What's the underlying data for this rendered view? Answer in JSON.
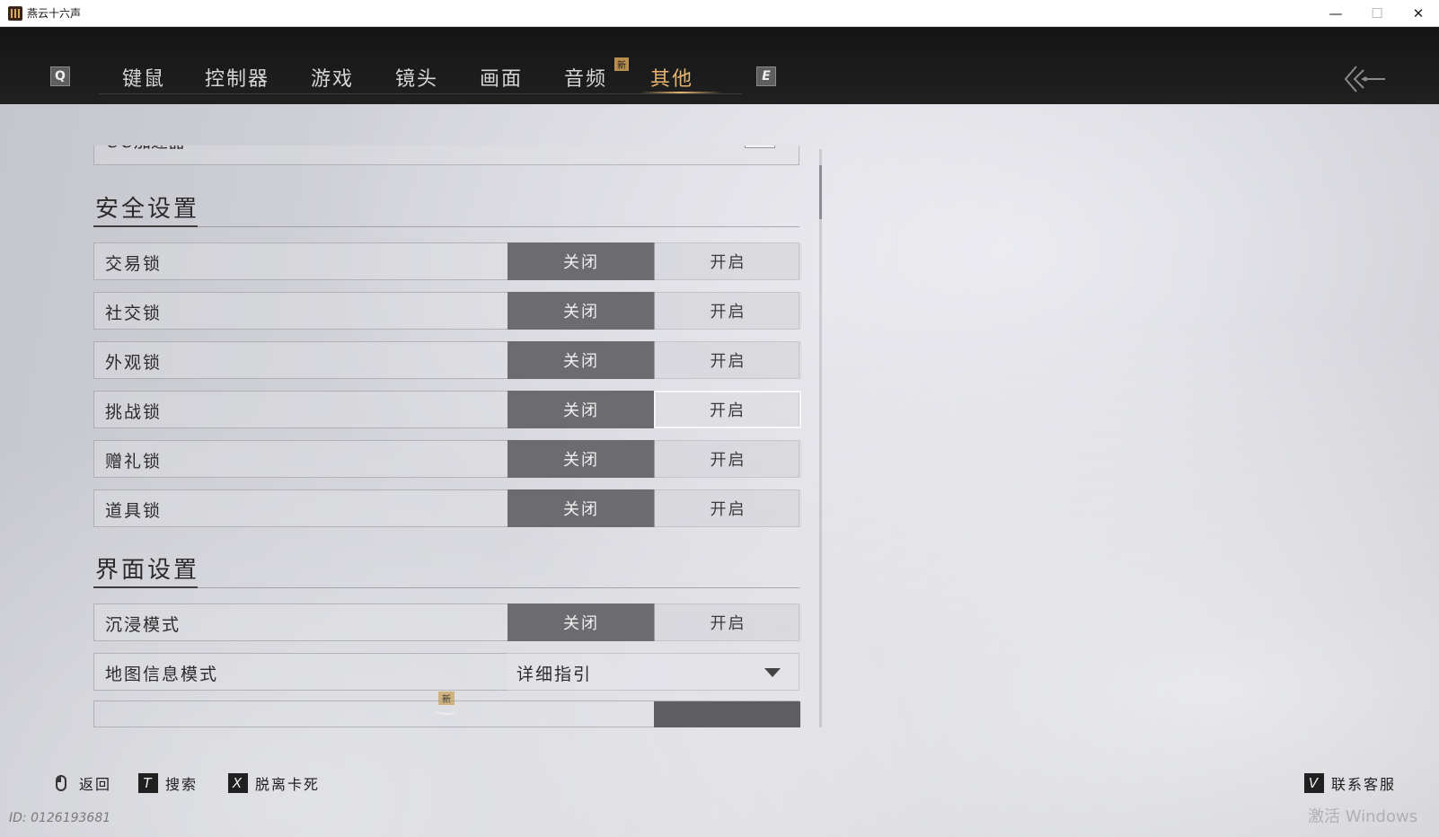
{
  "window": {
    "title": "燕云十六声",
    "minimize": "—",
    "maximize": "☐",
    "close": "✕"
  },
  "nav": {
    "left_key": "Q",
    "right_key": "E",
    "tabs": [
      {
        "label": "键鼠"
      },
      {
        "label": "控制器"
      },
      {
        "label": "游戏"
      },
      {
        "label": "镜头"
      },
      {
        "label": "画面"
      },
      {
        "label": "音频",
        "badge": "新"
      },
      {
        "label": "其他",
        "active": true
      }
    ]
  },
  "panel": {
    "top_partial_text": "UU加速器",
    "sections": [
      {
        "title": "安全设置",
        "rows": [
          {
            "label": "交易锁",
            "off": "关闭",
            "on": "开启"
          },
          {
            "label": "社交锁",
            "off": "关闭",
            "on": "开启"
          },
          {
            "label": "外观锁",
            "off": "关闭",
            "on": "开启"
          },
          {
            "label": "挑战锁",
            "off": "关闭",
            "on": "开启"
          },
          {
            "label": "赠礼锁",
            "off": "关闭",
            "on": "开启"
          },
          {
            "label": "道具锁",
            "off": "关闭",
            "on": "开启"
          }
        ]
      },
      {
        "title": "界面设置",
        "rows": [
          {
            "label": "沉浸模式",
            "off": "关闭",
            "on": "开启"
          }
        ],
        "dropdown": {
          "label": "地图信息模式",
          "value": "详细指引",
          "badge": "新"
        }
      }
    ]
  },
  "footer": {
    "back": "返回",
    "search_key": "T",
    "search": "搜索",
    "unstuck_key": "X",
    "unstuck": "脱离卡死",
    "support_key": "V",
    "support": "联系客服",
    "user_id": "ID: 0126193681",
    "watermark": "激活 Windows"
  }
}
